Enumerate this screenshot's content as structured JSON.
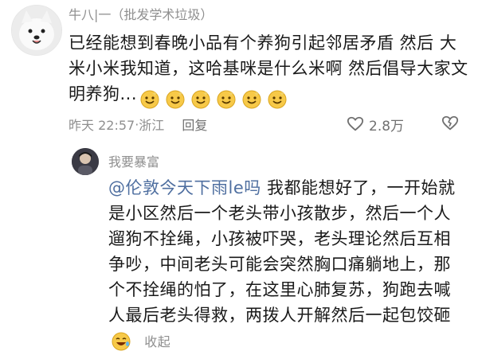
{
  "comment": {
    "username": "牛八|一（批发学术垃圾）",
    "text": "已经能想到春晚小品有个养狗引起邻居矛盾 然后 大米小米我知道，这哈基咪是什么米啊 然后倡导大家文明养狗...",
    "emoji_names": [
      "smile-emoji",
      "smile-emoji",
      "smile-emoji",
      "smile-emoji",
      "smile-emoji",
      "smile-emoji"
    ],
    "time": "昨天 22:57",
    "location": "浙江",
    "separator": " · ",
    "reply_label": "回复",
    "likes": "2.8万"
  },
  "reply": {
    "username": "我要暴富",
    "mention": "@伦敦今天下雨le吗",
    "text": " 我都能想好了，一开始就是小区然后一个老头带小孩散步，然后一个人遛狗不拴绳，小孩被吓哭，老头理论然后互相争吵，中间老头可能会突然胸口痛躺地上，那个不拴绳的怕了，在这里心肺复苏，狗跑去喊人最后老头得救，两拨人开解然后一起包饺砸",
    "emoji_name": "laugh-tear-emoji",
    "collapse_label": "收起"
  },
  "colors": {
    "mention": "#4f6fa0",
    "meta_gray": "#8f8f8f",
    "emoji_yellow": "#f7c948"
  }
}
